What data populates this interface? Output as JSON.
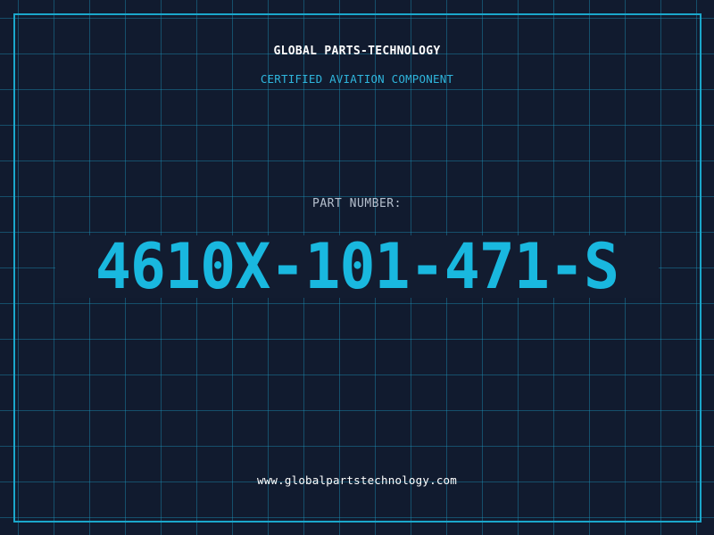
{
  "header": {
    "company_name": "GLOBAL PARTS-TECHNOLOGY",
    "tagline": "CERTIFIED AVIATION COMPONENT"
  },
  "part": {
    "label": "PART NUMBER:",
    "number": "4610X-101-471-S"
  },
  "footer": {
    "website": "www.globalpartstechnology.com"
  },
  "colors": {
    "background": "#111b2f",
    "grid": "#1c96be",
    "frame": "#1ba7cb",
    "accent": "#19b8df",
    "label": "#b6c0ce",
    "text": "#ffffff"
  }
}
